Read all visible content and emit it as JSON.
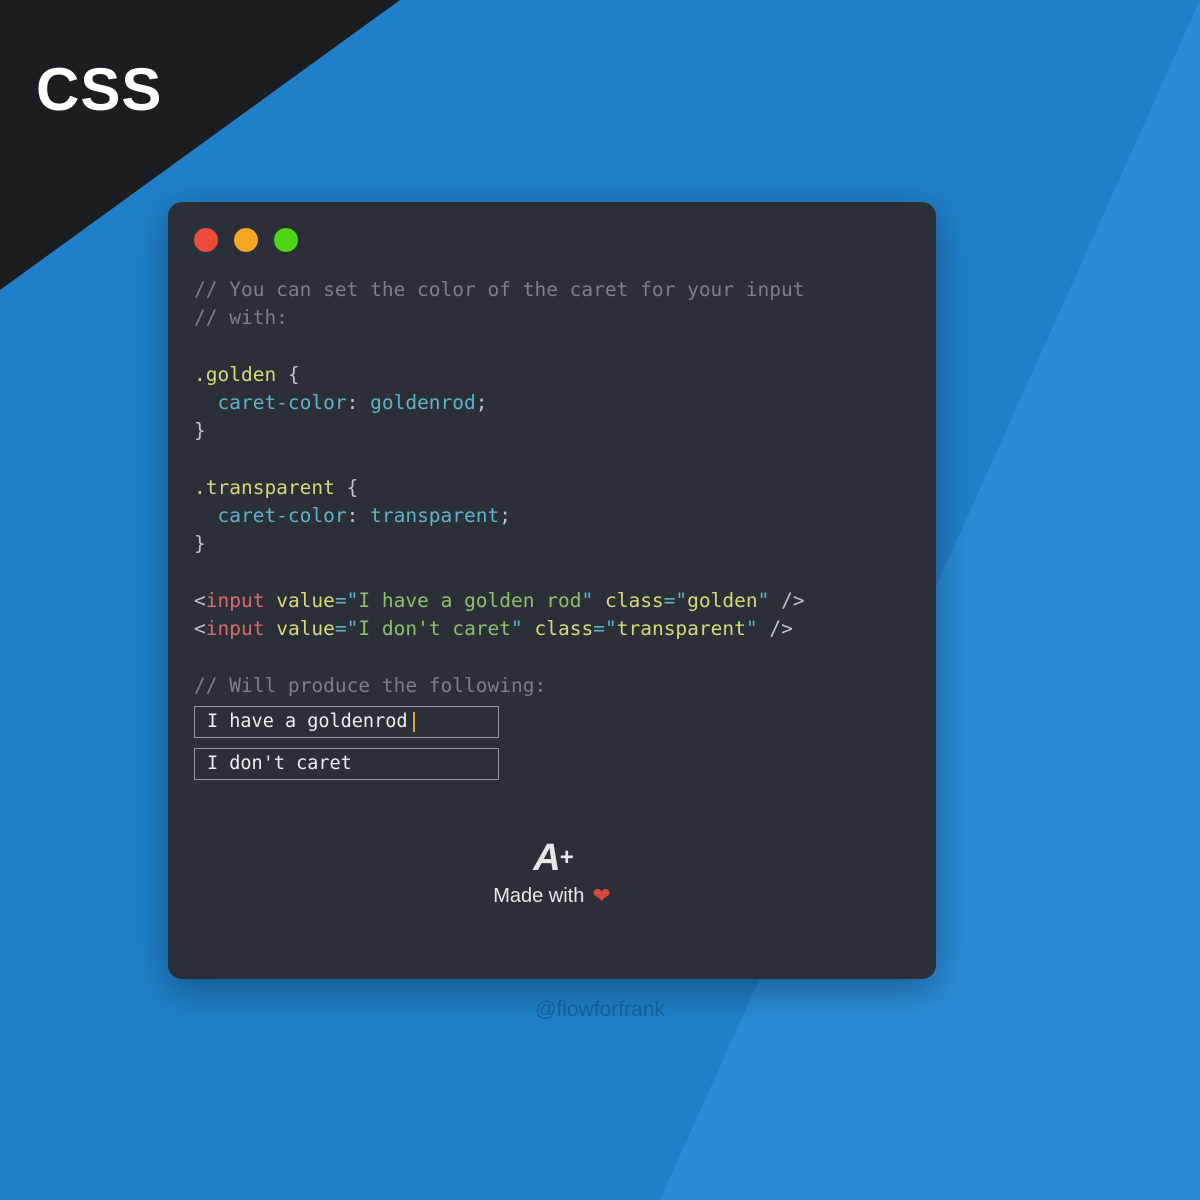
{
  "corner": {
    "label": "CSS"
  },
  "code": {
    "comment1": "// You can set the color of the caret for your input",
    "comment2": "// with:",
    "selector1": ".golden",
    "property": "caret-color",
    "value1": "goldenrod",
    "selector2": ".transparent",
    "value2": "transparent",
    "tag": "input",
    "attrValue": "value",
    "attrClass": "class",
    "inputValue1": "I have a golden rod",
    "inputClass1": "golden",
    "inputValue2": "I don't caret",
    "inputClass2": "transparent",
    "comment3": "// Will produce the following:"
  },
  "demo": {
    "input1": "I have a goldenrod",
    "input2": "I don't caret"
  },
  "footer": {
    "logoA": "A",
    "logoPlus": "+",
    "madeWith": "Made with",
    "heart": "❤"
  },
  "handle": "@flowforfrank"
}
